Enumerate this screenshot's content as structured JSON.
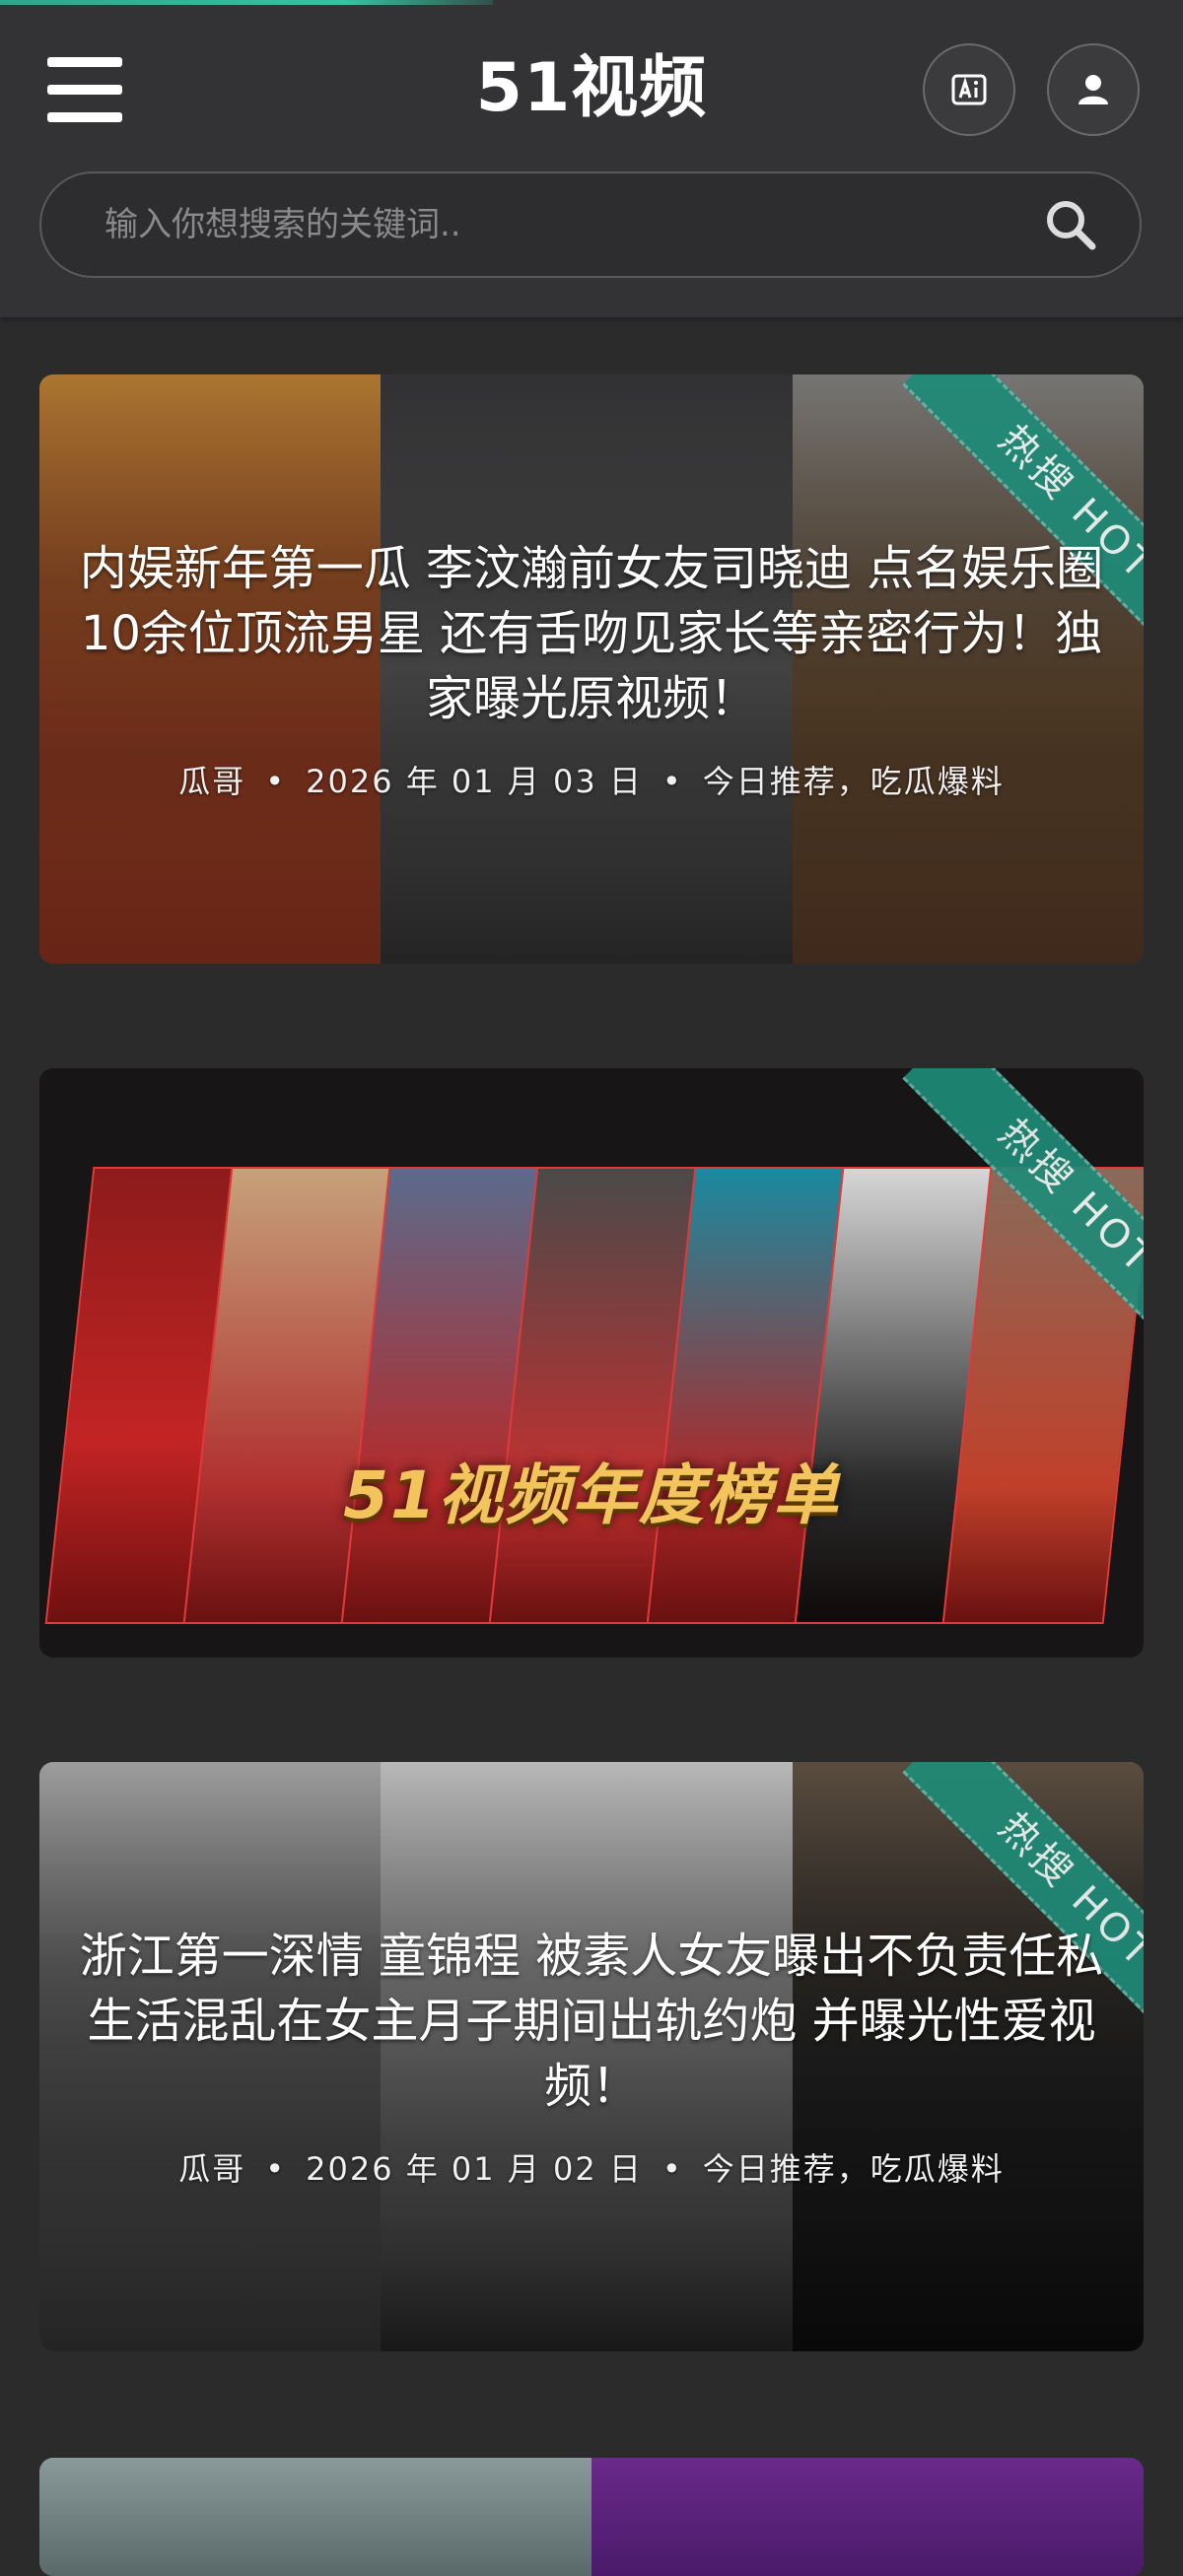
{
  "header": {
    "title": "51视频",
    "search_placeholder": "输入你想搜索的关键词.."
  },
  "icons": {
    "menu": "hamburger-menu-icon",
    "ai": "ai-icon",
    "user": "user-icon",
    "search": "search-icon",
    "hot_ribbon": "hot-ribbon"
  },
  "colors": {
    "accent": "#1f8b78",
    "progress": "#35c3a0",
    "banner_text": "#f2c45b"
  },
  "posts": [
    {
      "title": "内娱新年第一瓜 李汶瀚前女友司晓迪 点名娱乐圈10余位顶流男星 还有舌吻见家长等亲密行为！独家曝光原视频！",
      "author": "瓜哥",
      "date": "2026 年 01 月 03 日",
      "tags": "今日推荐，吃瓜爆料",
      "badge": "热搜 HOT"
    },
    {
      "banner_text": "51视频年度榜单",
      "badge": "热搜 HOT"
    },
    {
      "title": "浙江第一深情 童锦程 被素人女友曝出不负责任私生活混乱在女主月子期间出轨约炮 并曝光性爱视频！",
      "author": "瓜哥",
      "date": "2026 年 01 月 02 日",
      "tags": "今日推荐，吃瓜爆料",
      "badge": "热搜 HOT"
    }
  ]
}
